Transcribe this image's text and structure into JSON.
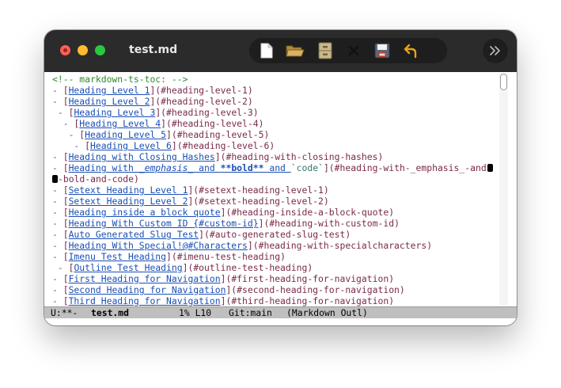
{
  "window": {
    "title": "test.md"
  },
  "toolbar": {
    "icons": [
      "new-file-icon",
      "open-folder-icon",
      "save-drawer-icon",
      "close-icon",
      "save-disk-icon",
      "undo-icon"
    ],
    "overflow_icon": "chevron-right-double-icon"
  },
  "editor": {
    "lines": [
      {
        "kind": "comment",
        "text": "<!-- markdown-ts-toc: -->"
      },
      {
        "kind": "toc",
        "prefix": "- ",
        "label": "Heading Level 1",
        "anchor": "#heading-level-1"
      },
      {
        "kind": "toc",
        "prefix": "- ",
        "label": "Heading Level 2",
        "anchor": "#heading-level-2"
      },
      {
        "kind": "toc",
        "prefix": " - ",
        "label": "Heading Level 3",
        "anchor": "#heading-level-3"
      },
      {
        "kind": "toc",
        "prefix": "  - ",
        "label": "Heading Level 4",
        "anchor": "#heading-level-4"
      },
      {
        "kind": "toc",
        "prefix": "   - ",
        "label": "Heading Level 5",
        "anchor": "#heading-level-5"
      },
      {
        "kind": "toc",
        "prefix": "    - ",
        "label": "Heading Level 6",
        "anchor": "#heading-level-6"
      },
      {
        "kind": "toc",
        "prefix": "- ",
        "label": "Heading with Closing Hashes",
        "anchor": "#heading-with-closing-hashes"
      },
      {
        "kind": "toc-rich",
        "prefix": "- ",
        "parts": [
          {
            "style": "link",
            "text": "Heading with "
          },
          {
            "style": "em",
            "text": "_emphasis_"
          },
          {
            "style": "link",
            "text": " and "
          },
          {
            "style": "bold",
            "text": "**bold**"
          },
          {
            "style": "link",
            "text": " and "
          },
          {
            "style": "code",
            "text": "`code`"
          }
        ],
        "anchor": "#heading-with-_emphasis_-and"
      },
      {
        "kind": "continuation",
        "text": "-bold-and-code)"
      },
      {
        "kind": "toc",
        "prefix": "- ",
        "label": "Setext Heading Level 1",
        "anchor": "#setext-heading-level-1"
      },
      {
        "kind": "toc",
        "prefix": "- ",
        "label": "Setext Heading Level 2",
        "anchor": "#setext-heading-level-2"
      },
      {
        "kind": "toc",
        "prefix": "- ",
        "label": "Heading inside a block quote",
        "anchor": "#heading-inside-a-block-quote"
      },
      {
        "kind": "toc",
        "prefix": "- ",
        "label": "Heading With Custom ID {#custom-id}",
        "anchor": "#heading-with-custom-id"
      },
      {
        "kind": "toc",
        "prefix": "- ",
        "label": "Auto Generated Slug Test",
        "anchor": "#auto-generated-slug-test"
      },
      {
        "kind": "toc",
        "prefix": "- ",
        "label": "Heading With Special!@#Characters",
        "anchor": "#heading-with-specialcharacters"
      },
      {
        "kind": "toc",
        "prefix": "- ",
        "label": "Imenu Test Heading",
        "anchor": "#imenu-test-heading"
      },
      {
        "kind": "toc",
        "prefix": " - ",
        "label": "Outline Test Heading",
        "anchor": "#outline-test-heading"
      },
      {
        "kind": "toc",
        "prefix": "- ",
        "label": "First Heading for Navigation",
        "anchor": "#first-heading-for-navigation"
      },
      {
        "kind": "toc",
        "prefix": "- ",
        "label": "Second Heading for Navigation",
        "anchor": "#second-heading-for-navigation"
      },
      {
        "kind": "toc",
        "prefix": "- ",
        "label": "Third Heading for Navigation",
        "anchor": "#third-heading-for-navigation"
      }
    ]
  },
  "modeline": {
    "status": "U:**-",
    "buffer": "test.md",
    "position": "1% L10",
    "vc": "Git:main",
    "mode": "(Markdown Outl)"
  },
  "colors": {
    "titlebar": "#2b2b2b",
    "link": "#1a4fb5",
    "url": "#7a2a4a",
    "comment": "#2e8b2e",
    "modeline": "#bfbfbf"
  }
}
